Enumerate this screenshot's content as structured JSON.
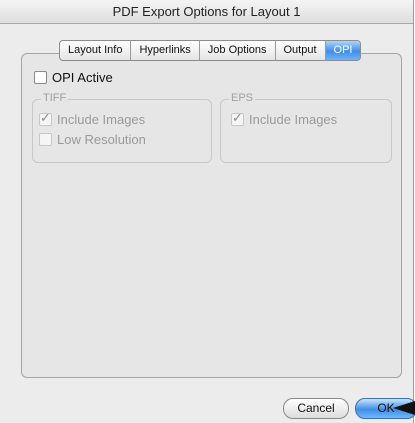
{
  "window": {
    "title": "PDF Export Options for Layout 1"
  },
  "tabs": [
    {
      "label": "Layout Info",
      "selected": false
    },
    {
      "label": "Hyperlinks",
      "selected": false
    },
    {
      "label": "Job Options",
      "selected": false
    },
    {
      "label": "Output",
      "selected": false
    },
    {
      "label": "OPI",
      "selected": true
    }
  ],
  "opi": {
    "active_label": "OPI Active",
    "active_checked": false,
    "tiff": {
      "title": "TIFF",
      "include_images_label": "Include Images",
      "include_images_checked": true,
      "low_res_label": "Low Resolution",
      "low_res_checked": false
    },
    "eps": {
      "title": "EPS",
      "include_images_label": "Include Images",
      "include_images_checked": true
    }
  },
  "buttons": {
    "cancel_label": "Cancel",
    "ok_label": "OK"
  },
  "colors": {
    "accent": "#3f8ee8",
    "window_bg": "#ececec"
  }
}
